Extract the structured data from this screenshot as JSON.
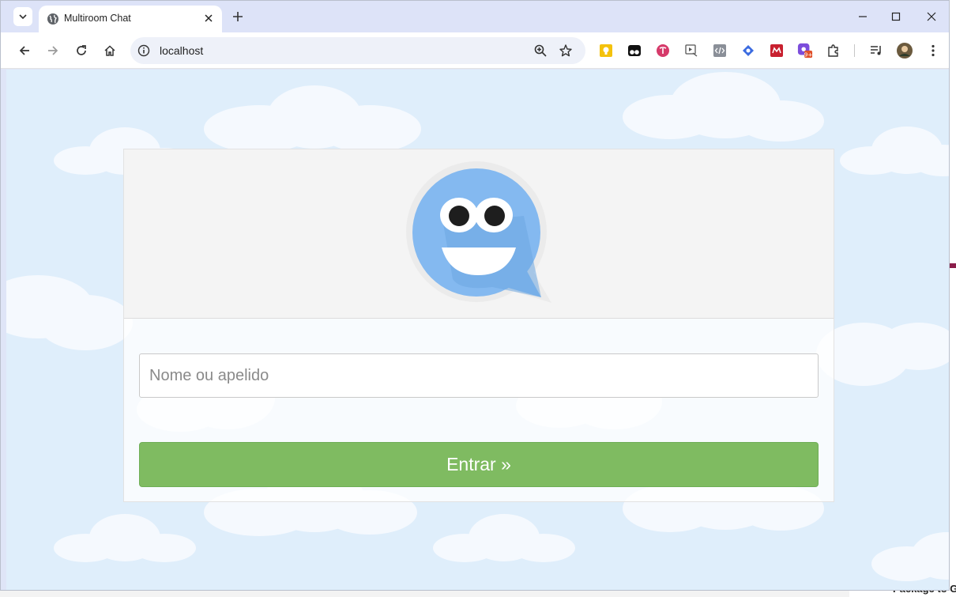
{
  "browser": {
    "tab": {
      "title": "Multiroom Chat"
    },
    "address": {
      "url": "localhost"
    }
  },
  "page": {
    "name_input": {
      "placeholder": "Nome ou apelido",
      "value": ""
    },
    "enter_button": {
      "label": "Entrar »"
    }
  },
  "background_app": {
    "bottom_text": "Package to G"
  },
  "colors": {
    "sky": "#dfeefb",
    "button": "#7fbb61",
    "logo_blue": "#7fb8ef"
  }
}
